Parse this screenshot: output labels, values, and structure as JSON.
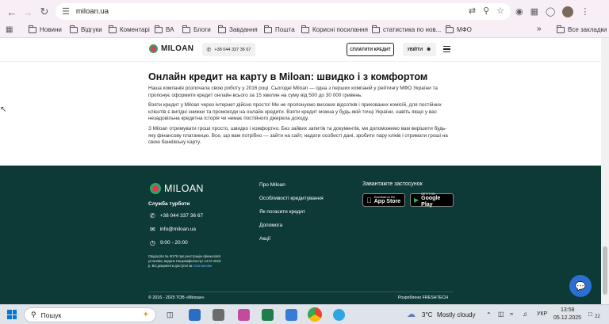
{
  "browser": {
    "url": "miloan.ua",
    "bookmarks": [
      "Новини",
      "Відгуки",
      "Коментарі",
      "ВА",
      "Блоги",
      "Завдання",
      "Пошта",
      "Корисні посилання",
      "статистика по нов...",
      "МФО"
    ],
    "all_bookmarks": "Все закладки",
    "more": "»"
  },
  "header": {
    "logo": "MILOAN",
    "phone": "+38 044 337 36 67",
    "pay_button": "СПЛАТИТИ КРЕДИТ",
    "login_button": "УВІЙТИ"
  },
  "article": {
    "title": "Онлайн кредит на карту в Miloan: швидко і з комфортом",
    "p1": "Наша компанія розпочала свою роботу у 2016 році. Сьогодні Miloan — одна з перших компаній у рейтингу МФО України та пропонує оформити кредит онлайн всього за 15 хвилин на суму від 500 до 30 000 гривень.",
    "p2": "Взяти кредит у Miloan через інтернет дійсно просто! Ми не пропонуємо високих відсотків і прихованих комісій, для постійних клієнтів є вигідні знижки та промокоди на онлайн кредити. Взяти кредит можна у будь-якій точці України, навіть якщо у вас незадовільна кредитна історія чи немає постійного джерела доходу.",
    "p3": "З Miloan отримувати гроші просто, швидко і комфортно. Без зайвих запитів та документів, ми допоможемо вам вирішити будь-яку фінансову платаницю. Все, що вам потрібно — зайти на сайт, надати особисті дані, зробити пару кліків і отримати гроші на свою банківську карту."
  },
  "footer": {
    "logo": "MILOAN",
    "support_title": "Служба турботи",
    "phone": "+38 044 337 36 67",
    "email": "info@miloan.ua",
    "hours": "9:00 - 20:00",
    "license_text": "Свідоцтво № ІК176 про реєстрацію фінансової установи, видане Нацкомфінпослуг 14.07.2016 р. Всі документи доступні за",
    "license_link": "посиланням",
    "links": [
      "Про Miloan",
      "Особливості кредитування",
      "Як погасити кредит",
      "Допомога",
      "Акції"
    ],
    "apps_title": "Завантажте застосунок",
    "appstore_sub": "Download on the",
    "appstore_main": "App Store",
    "gplay_sub": "GET IT ON",
    "gplay_main": "Google Play",
    "copyright": "© 2016 - 2025 ТОВ «Мілоан»",
    "developer": "Розроблено FRESHTECH"
  },
  "taskbar": {
    "search_placeholder": "Пошук",
    "weather": "3°C",
    "weather_desc": "Mostly cloudy",
    "lang": "УКР",
    "time": "13:58",
    "date": "05.12.2025",
    "notif_count": "22"
  },
  "colors": {
    "footer_bg": "#0d3a36",
    "brand_green": "#2aa66b",
    "brand_red": "#e8394a",
    "chat_blue": "#2a6fd1"
  }
}
